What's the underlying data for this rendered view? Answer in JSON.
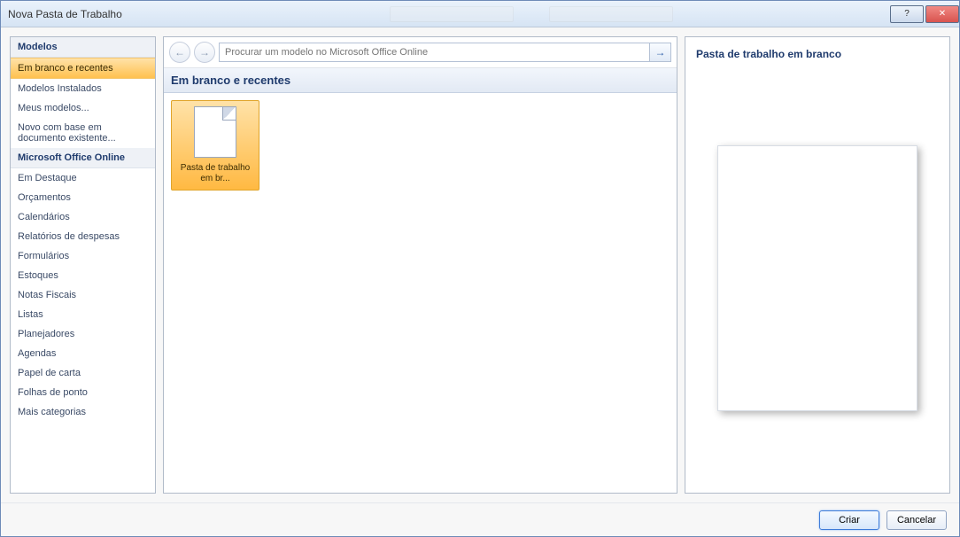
{
  "window": {
    "title": "Nova Pasta de Trabalho"
  },
  "sidebar": {
    "heading_templates": "Modelos",
    "heading_online": "Microsoft Office Online",
    "items_top": [
      "Em branco e recentes",
      "Modelos Instalados",
      "Meus modelos...",
      "Novo com base em documento existente..."
    ],
    "items_online": [
      "Em Destaque",
      "Orçamentos",
      "Calendários",
      "Relatórios de despesas",
      "Formulários",
      "Estoques",
      "Notas Fiscais",
      "Listas",
      "Planejadores",
      "Agendas",
      "Papel de carta",
      "Folhas de ponto",
      "Mais categorias"
    ],
    "selected_index_top": 0
  },
  "middle": {
    "search_placeholder": "Procurar um modelo no Microsoft Office Online",
    "category_heading": "Em branco e recentes",
    "templates": [
      {
        "label": "Pasta de trabalho em br..."
      }
    ],
    "selected_template_index": 0
  },
  "preview": {
    "title": "Pasta de trabalho em branco"
  },
  "footer": {
    "create_label": "Criar",
    "cancel_label": "Cancelar"
  }
}
